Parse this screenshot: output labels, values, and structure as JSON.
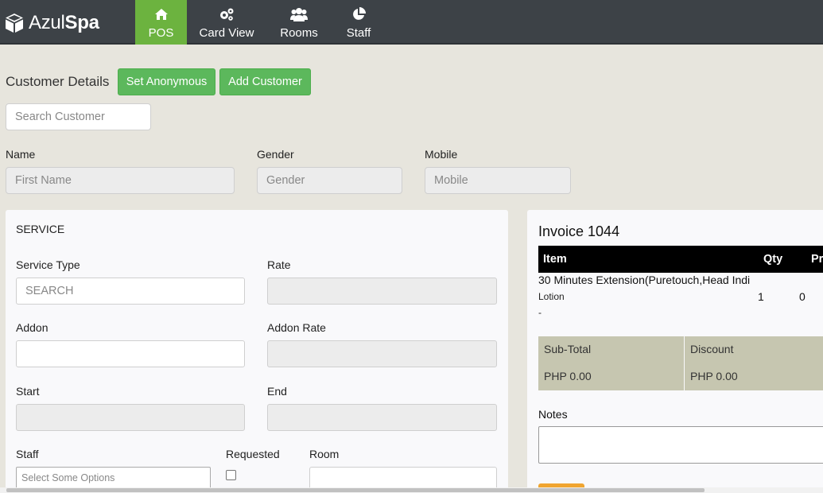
{
  "brand": {
    "part1": "Azul",
    "part2": "Spa"
  },
  "nav": {
    "pos": "POS",
    "card_view": "Card View",
    "rooms": "Rooms",
    "staff": "Staff"
  },
  "customer": {
    "title": "Customer Details",
    "set_anonymous": "Set Anonymous",
    "add_customer": "Add Customer",
    "search_placeholder": "Search Customer",
    "name_label": "Name",
    "gender_label": "Gender",
    "mobile_label": "Mobile",
    "name_placeholder": "First Name",
    "gender_placeholder": "Gender",
    "mobile_placeholder": "Mobile"
  },
  "service": {
    "title": "SERVICE",
    "service_type_label": "Service Type",
    "service_type_placeholder": "SEARCH",
    "rate_label": "Rate",
    "addon_label": "Addon",
    "addon_rate_label": "Addon Rate",
    "start_label": "Start",
    "end_label": "End",
    "staff_label": "Staff",
    "staff_placeholder": "Select Some Options",
    "requested_label": "Requested",
    "room_label": "Room"
  },
  "invoice": {
    "title": "Invoice 1044",
    "columns": [
      "Item",
      "Qty",
      "Pric"
    ],
    "items": [
      {
        "name": "30 Minutes Extension(Puretouch,Head Indi",
        "sub": "Lotion",
        "note": "-",
        "qty": "1",
        "price": "0"
      }
    ],
    "subtotal_label": "Sub-Total",
    "subtotal_value": "PHP 0.00",
    "discount_label": "Discount",
    "discount_value": "PHP 0.00",
    "notes_label": "Notes"
  },
  "colors": {
    "navbar": "#3d4247",
    "active_tab": "#6cb33f",
    "button_green": "#5cb85c",
    "totals_bg": "#c6c6b0",
    "background": "#e7e5dd"
  },
  "icons": {
    "brand": "cube-icon",
    "pos": "home-icon",
    "card_view": "gears-icon",
    "rooms": "users-icon",
    "staff": "pie-chart-icon"
  }
}
